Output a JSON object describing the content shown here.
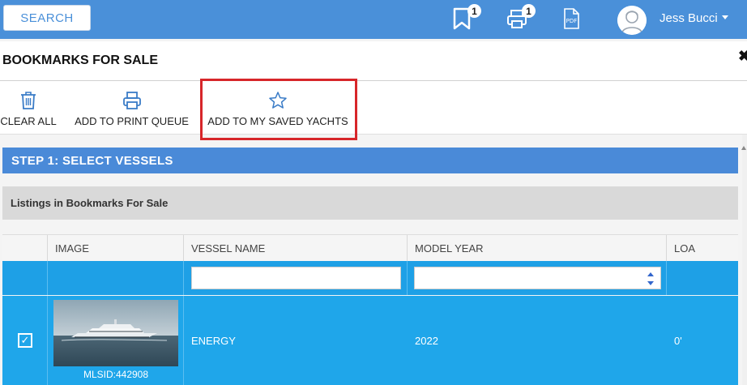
{
  "topbar": {
    "search_label": "SEARCH",
    "bookmark_count": "1",
    "print_count": "1",
    "user_name": "Jess Bucci"
  },
  "dialog": {
    "title": "BOOKMARKS FOR SALE",
    "close_glyph": "✖"
  },
  "toolbar": {
    "clear_all": "CLEAR ALL",
    "add_print": "ADD TO PRINT QUEUE",
    "add_saved": "ADD TO MY SAVED YACHTS"
  },
  "step": {
    "title": "STEP 1: SELECT VESSELS",
    "listings_label": "Listings in Bookmarks For Sale"
  },
  "table": {
    "columns": [
      "",
      "IMAGE",
      "VESSEL NAME",
      "MODEL YEAR",
      "LOA"
    ],
    "filters": {
      "vessel_name": "",
      "model_year": ""
    },
    "rows": [
      {
        "checked_glyph": "✓",
        "mlsid": "MLSID:442908",
        "vessel_name": "ENERGY",
        "model_year": "2022",
        "loa": "0'"
      }
    ]
  },
  "colors": {
    "topbar": "#4a90d9",
    "step_header": "#4a8ad8",
    "selected_row": "#1fa6ea",
    "highlight": "#d7262a"
  },
  "icons": [
    "bookmark-icon",
    "printer-icon",
    "pdf-icon",
    "trash-icon",
    "star-icon",
    "close-icon",
    "user-avatar-icon"
  ]
}
